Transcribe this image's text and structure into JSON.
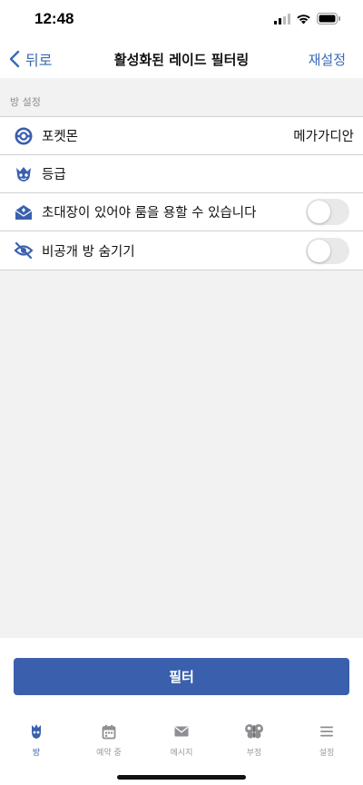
{
  "status_bar": {
    "time": "12:48"
  },
  "nav": {
    "back_label": "뒤로",
    "title": "활성화된 레이드 필터링",
    "reset_label": "재설정"
  },
  "section": {
    "header": "방 설정"
  },
  "rows": [
    {
      "label": "포켓몬",
      "value": "메가가디안",
      "icon": "pokeball-icon"
    },
    {
      "label": "등급",
      "icon": "raid-boss-icon"
    },
    {
      "label": "초대장이 있어야 룸을 용할 수 있습니다",
      "icon": "invitation-icon",
      "toggle_on": false
    },
    {
      "label": "비공개 방 숨기기",
      "icon": "eye-slash-icon",
      "toggle_on": false
    }
  ],
  "filter_button": {
    "label": "필터"
  },
  "tabs": [
    {
      "label": "방",
      "icon": "raid-icon",
      "active": true
    },
    {
      "label": "예약 중",
      "icon": "calendar-icon",
      "active": false
    },
    {
      "label": "메시지",
      "icon": "mail-icon",
      "active": false
    },
    {
      "label": "부정",
      "icon": "butterfly-icon",
      "active": false
    },
    {
      "label": "설정",
      "icon": "menu-icon",
      "active": false
    }
  ],
  "colors": {
    "accent": "#3a6ab5",
    "button": "#3a60ad",
    "toggle_off": "#e9e9ea"
  }
}
